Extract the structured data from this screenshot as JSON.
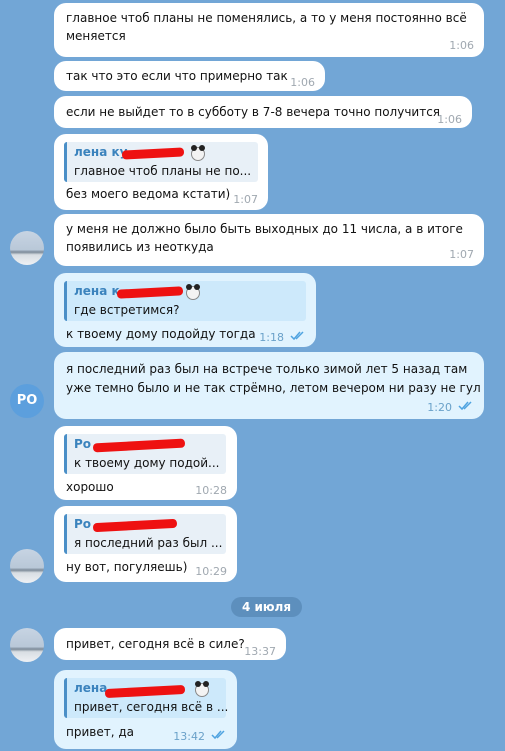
{
  "messages": [
    {
      "lines": [
        "главное чтоб планы не поменялись, а то у меня постоянно всё",
        "меняется"
      ],
      "time": "1:06"
    },
    {
      "lines": [
        "так что это если что примерно так"
      ],
      "time": "1:06"
    },
    {
      "lines": [
        "если не выйдет то в субботу в 7-8 вечера точно получится"
      ],
      "time": "1:06"
    },
    {
      "reply_name": "лена ку",
      "reply_text": "главное чтоб планы не по...",
      "lines": [
        "без моего ведома кстати)"
      ],
      "time": "1:07"
    },
    {
      "lines": [
        "у меня не должно было быть выходных до 11 числа, а в итоге",
        "появились из неоткуда"
      ],
      "time": "1:07"
    },
    {
      "reply_name": "лена к",
      "reply_text": "где встретимся?",
      "lines": [
        "к твоему дому подойду тогда"
      ],
      "time": "1:18"
    },
    {
      "lines": [
        "я последний раз был на встрече только зимой лет 5 назад там",
        "уже темно было и не так стрёмно, летом вечером ни разу не гул"
      ],
      "time": "1:20"
    },
    {
      "reply_name": "Ро",
      "reply_text": "к твоему дому подой...",
      "lines": [
        "хорошо"
      ],
      "time": "10:28"
    },
    {
      "reply_name": "Ро",
      "reply_text": "я последний раз был ...",
      "lines": [
        "ну вот, погуляешь)"
      ],
      "time": "10:29"
    },
    {
      "lines": [
        "привет, сегодня всё в силе?"
      ],
      "time": "13:37"
    },
    {
      "reply_name": "лена",
      "reply_text": "привет, сегодня всё в ...",
      "lines": [
        "привет, да"
      ],
      "time": "13:42"
    }
  ],
  "date_separator": "4 июля",
  "avatar_initials": "РО",
  "colors": {
    "background": "#72a6d6",
    "incoming_bubble": "#ffffff",
    "outgoing_bubble": "#e1f3fe",
    "reply_accent": "#4a8fc7",
    "redaction": "#ee1111",
    "read_check": "#4fa3e0"
  }
}
